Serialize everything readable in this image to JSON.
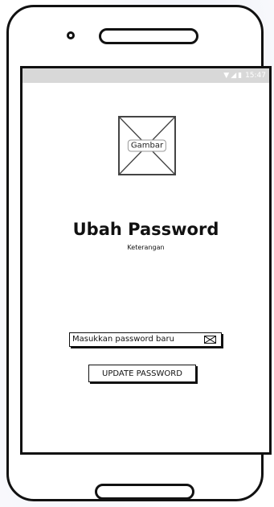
{
  "status_bar": {
    "time": "15:47",
    "icons": [
      "wifi-icon",
      "signal-icon",
      "battery-icon"
    ]
  },
  "image_placeholder": {
    "label": "Gambar"
  },
  "header": {
    "title": "Ubah Password",
    "subtitle": "Keterangan"
  },
  "form": {
    "password_placeholder": "Masukkan password baru",
    "password_icon": "mail-icon",
    "submit_label": "UPDATE PASSWORD"
  },
  "colors": {
    "outline": "#111111",
    "status_bar": "#d8d8d8",
    "background": "#ffffff"
  }
}
